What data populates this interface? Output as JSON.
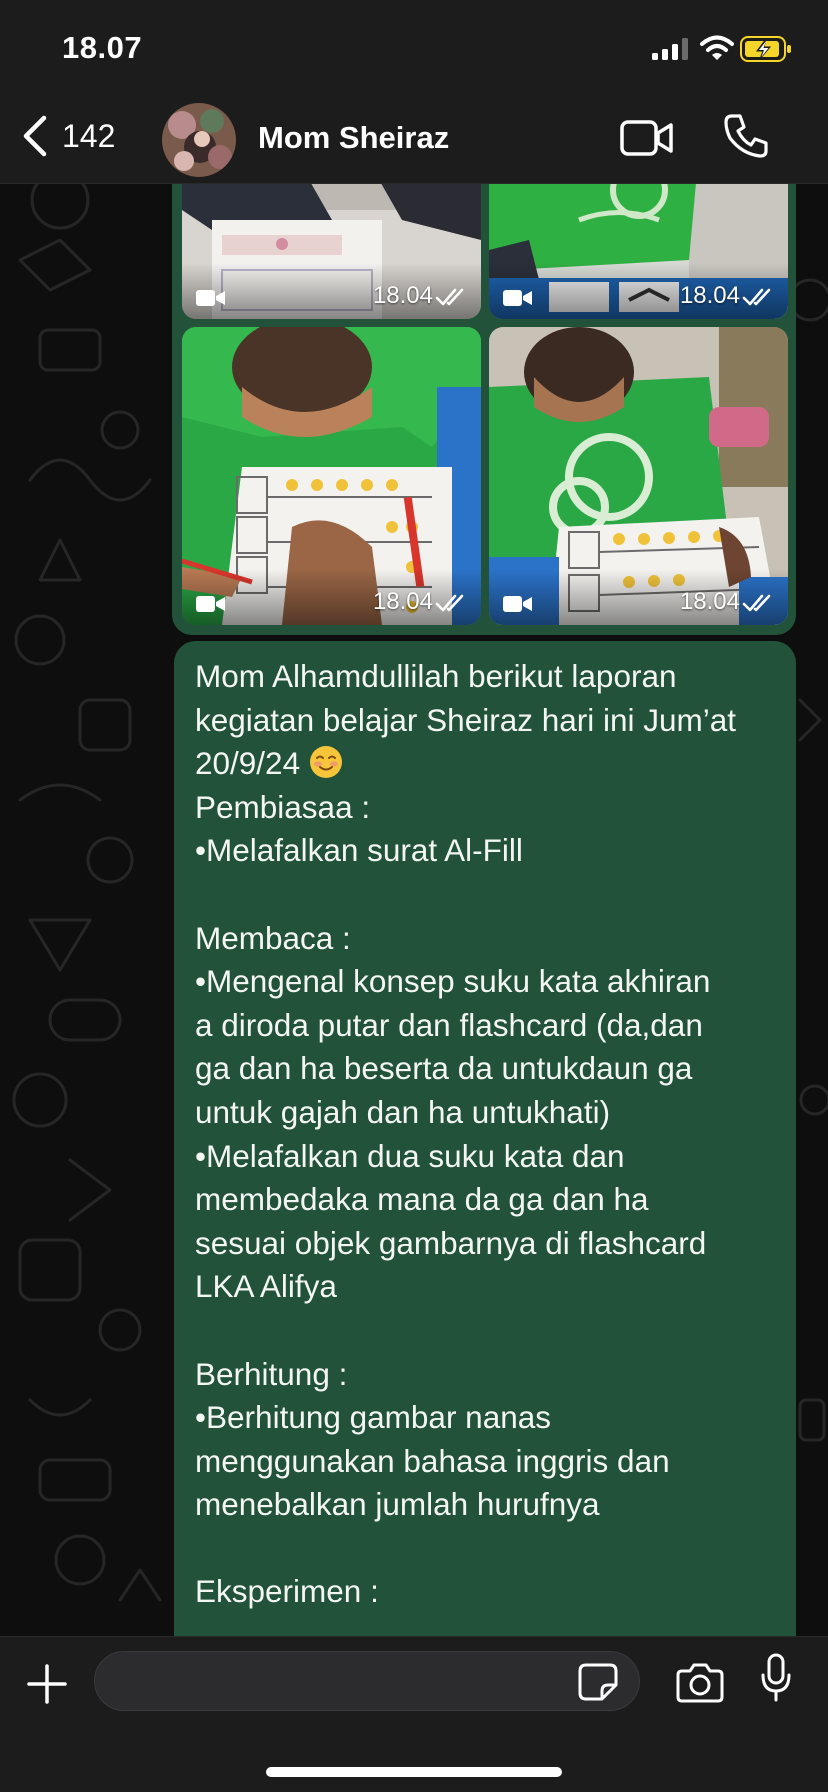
{
  "status_bar": {
    "time": "18.07",
    "icons": [
      "cellular-signal-icon",
      "wifi-icon",
      "battery-charging-icon"
    ]
  },
  "header": {
    "back_count": "142",
    "contact_name": "Mom Sheiraz",
    "icons": [
      "back-chevron-icon",
      "video-camera-icon",
      "phone-icon"
    ]
  },
  "media": {
    "items": [
      {
        "type": "video",
        "time": "18.04",
        "status": "read"
      },
      {
        "type": "video",
        "time": "18.04",
        "status": "read"
      },
      {
        "type": "video",
        "time": "18.04",
        "status": "read"
      },
      {
        "type": "video",
        "time": "18.04",
        "status": "read"
      }
    ]
  },
  "message": {
    "lines": [
      "Mom Alhamdullilah berikut laporan",
      "kegiatan belajar Sheiraz hari ini Jum’at",
      "20/9/24 ",
      "Pembiasaa :",
      "•Melafalkan surat Al-Fill",
      "",
      "Membaca :",
      "•Mengenal konsep suku kata akhiran",
      "a diroda putar dan flashcard (da,dan",
      "ga dan ha beserta da untukdaun ga",
      "untuk gajah dan ha untukhati)",
      "•Melafalkan dua suku kata dan",
      "membedaka mana da ga dan ha",
      "sesuai objek gambarnya di flashcard",
      "LKA Alifya",
      "",
      "Berhitung :",
      "•Berhitung gambar nanas",
      "menggunakan bahasa inggris dan",
      "menebalkan jumlah hurufnya",
      "",
      "Eksperimen :"
    ],
    "emoji": "smiling-face-icon"
  },
  "input_bar": {
    "placeholder": "",
    "icons": [
      "plus-icon",
      "sticker-icon",
      "camera-icon",
      "microphone-icon"
    ]
  },
  "colors": {
    "bubble": "#225239",
    "bar": "#1c1c1c",
    "background": "#0e0e0e",
    "battery_fill": "#f5d52a"
  }
}
